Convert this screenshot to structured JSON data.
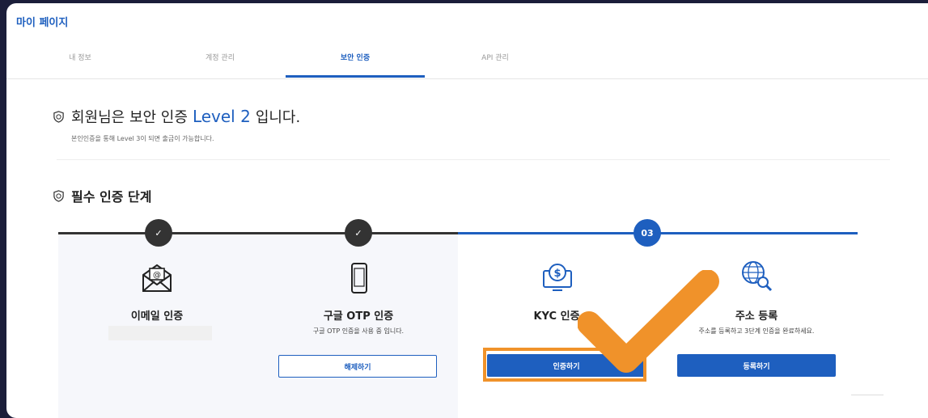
{
  "header": {
    "title": "마이 페이지"
  },
  "tabs": [
    {
      "label": "내 정보"
    },
    {
      "label": "계정 관리"
    },
    {
      "label": "보안 인증"
    },
    {
      "label": "API 관리"
    }
  ],
  "level": {
    "prefix": "회원님은 보안 인증",
    "value": "Level 2",
    "suffix": "입니다.",
    "subtext": "본인인증을 통해 Level 3이 되면 출금이 가능합니다."
  },
  "steps_section": {
    "title": "필수 인증 단계"
  },
  "steps": [
    {
      "marker": "✓",
      "label": "이메일 인증",
      "desc": ""
    },
    {
      "marker": "✓",
      "label": "구글 OTP 인증",
      "desc": "구글 OTP 인증을 사용 중 입니다.",
      "button": "해제하기"
    },
    {
      "marker": "03",
      "label": "KYC 인증",
      "desc": "",
      "button": "인증하기"
    },
    {
      "marker": "",
      "label": "주소 등록",
      "desc": "주소를 등록하고 3단계 인증을 완료하세요.",
      "button": "등록하기"
    }
  ],
  "colors": {
    "accent": "#1e5fbf",
    "highlight": "#f0922a",
    "dark": "#333333"
  }
}
